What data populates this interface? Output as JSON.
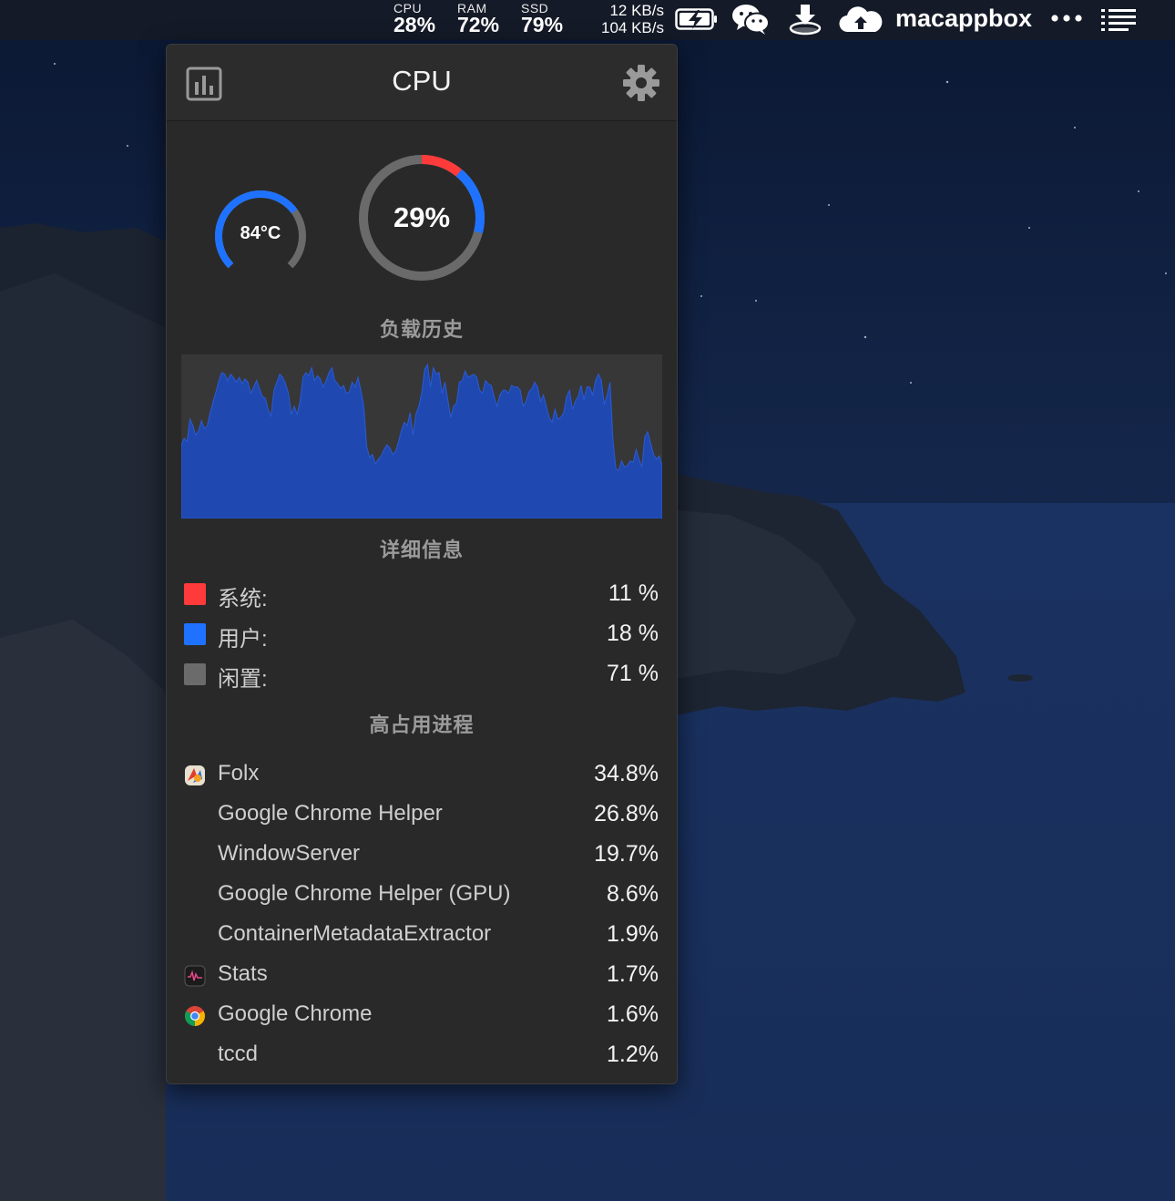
{
  "menubar": {
    "cpu": {
      "label": "CPU",
      "value": "28%"
    },
    "ram": {
      "label": "RAM",
      "value": "72%"
    },
    "ssd": {
      "label": "SSD",
      "value": "79%"
    },
    "net_up": "12 KB/s",
    "net_down": "104 KB/s",
    "user": "macappbox",
    "icons": [
      "battery-charging-icon",
      "wechat-icon",
      "download-icon",
      "cloud-icon",
      "more-icon",
      "list-icon"
    ]
  },
  "panel": {
    "title": "CPU",
    "temperature": "84°C",
    "temperature_level": 0.7,
    "load": "29%",
    "load_system_fraction": 0.11,
    "load_user_fraction": 0.18,
    "history_title": "负载历史",
    "details_title": "详细信息",
    "details": [
      {
        "name": "系统:",
        "value": "11 %",
        "color": "#ff3a3a"
      },
      {
        "name": "用户:",
        "value": "18 %",
        "color": "#1f72ff"
      },
      {
        "name": "闲置:",
        "value": "71 %",
        "color": "#6b6b6b"
      }
    ],
    "processes_title": "高占用进程",
    "processes": [
      {
        "name": "Folx",
        "value": "34.8%",
        "icon": "folx-icon"
      },
      {
        "name": "Google Chrome Helper",
        "value": "26.8%",
        "icon": ""
      },
      {
        "name": "WindowServer",
        "value": "19.7%",
        "icon": ""
      },
      {
        "name": "Google Chrome Helper (GPU)",
        "value": "8.6%",
        "icon": ""
      },
      {
        "name": "ContainerMetadataExtractor",
        "value": "1.9%",
        "icon": ""
      },
      {
        "name": "Stats",
        "value": "1.7%",
        "icon": "stats-app-icon"
      },
      {
        "name": "Google Chrome",
        "value": "1.6%",
        "icon": "chrome-icon"
      },
      {
        "name": "tccd",
        "value": "1.2%",
        "icon": ""
      }
    ],
    "colors": {
      "accent": "#1f72ff",
      "system": "#ff3a3a",
      "idle": "#6b6b6b",
      "history_fill": "#1f49b0"
    }
  },
  "chart_data": {
    "type": "area",
    "title": "负载历史",
    "ylim": [
      0,
      100
    ],
    "values": [
      46,
      50,
      48,
      62,
      58,
      52,
      55,
      61,
      56,
      58,
      66,
      73,
      79,
      86,
      91,
      90,
      86,
      90,
      88,
      85,
      88,
      84,
      87,
      85,
      78,
      82,
      86,
      81,
      76,
      75,
      68,
      64,
      80,
      85,
      90,
      88,
      84,
      78,
      65,
      70,
      65,
      73,
      88,
      91,
      89,
      94,
      86,
      89,
      87,
      82,
      86,
      91,
      94,
      86,
      84,
      81,
      83,
      78,
      79,
      85,
      82,
      88,
      80,
      70,
      45,
      38,
      40,
      34,
      37,
      39,
      43,
      46,
      44,
      40,
      42,
      48,
      55,
      60,
      58,
      66,
      52,
      65,
      70,
      78,
      93,
      96,
      82,
      94,
      90,
      91,
      78,
      85,
      74,
      63,
      70,
      72,
      85,
      86,
      92,
      88,
      89,
      90,
      88,
      80,
      78,
      86,
      84,
      83,
      76,
      70,
      77,
      80,
      80,
      78,
      83,
      82,
      82,
      80,
      70,
      73,
      79,
      81,
      85,
      82,
      73,
      77,
      70,
      63,
      60,
      68,
      62,
      63,
      66,
      76,
      80,
      68,
      73,
      76,
      83,
      74,
      82,
      82,
      77,
      86,
      90,
      86,
      71,
      77,
      85,
      49,
      31,
      30,
      36,
      32,
      33,
      36,
      35,
      43,
      37,
      32,
      51,
      54,
      47,
      40,
      37,
      39,
      33
    ]
  }
}
